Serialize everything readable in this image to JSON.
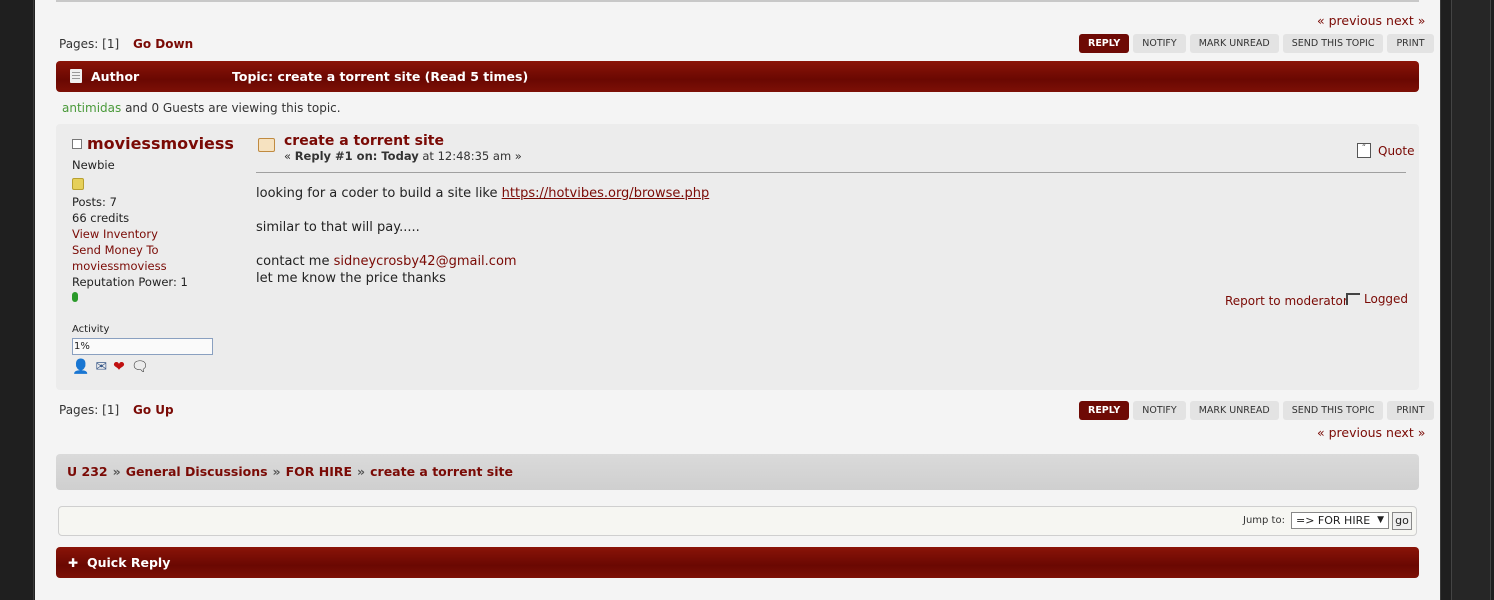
{
  "nav": {
    "prev_next": "« previous next »",
    "pages_label": "Pages: [",
    "page_num": "1",
    "pages_close": "]",
    "go_down": "Go Down",
    "go_up": "Go Up"
  },
  "buttons": {
    "reply": "REPLY",
    "notify": "NOTIFY",
    "mark_unread": "MARK UNREAD",
    "send_topic": "SEND THIS TOPIC",
    "print": "PRINT"
  },
  "header": {
    "author": "Author",
    "topic": "Topic: create a torrent site  (Read 5 times)"
  },
  "viewing": {
    "user": "antimidas",
    "rest": "and 0 Guests are viewing this topic."
  },
  "poster": {
    "name": "moviessmoviess",
    "rank": "Newbie",
    "posts": "Posts: 7",
    "credits": "66 credits",
    "view_inventory": "View Inventory",
    "send_money": "Send Money To",
    "send_money_user": "moviessmoviess",
    "reputation": "Reputation Power: 1",
    "activity_label": "Activity",
    "activity_value": "1%"
  },
  "post": {
    "subject": "create a torrent site",
    "reply_prefix": "« ",
    "reply_num": "Reply #1 on: Today",
    "reply_time": " at 12:48:35 am »",
    "quote": "Quote",
    "line1": "looking for a coder to build a site like ",
    "link": "https://hotvibes.org/browse.php",
    "line2": "similar to that will pay.....",
    "line3": "contact me ",
    "email": "sidneycrosby42@gmail.com",
    "line4": "let me know the price thanks",
    "report": "Report to moderator",
    "logged": "Logged"
  },
  "linktree": {
    "items": [
      "U 232",
      "General Discussions",
      "FOR HIRE",
      "create a torrent site"
    ],
    "separator": "»"
  },
  "jump": {
    "label": "Jump to:",
    "selected": "=> FOR HIRE",
    "go": "go"
  },
  "quick_reply": {
    "title": "Quick Reply"
  },
  "icons": {
    "header": "document-icon",
    "profile": "profile-icon",
    "email": "email-icon",
    "heart": "heart-icon",
    "pm": "speech-bubble-icon",
    "quick_reply": "plus-icon"
  }
}
